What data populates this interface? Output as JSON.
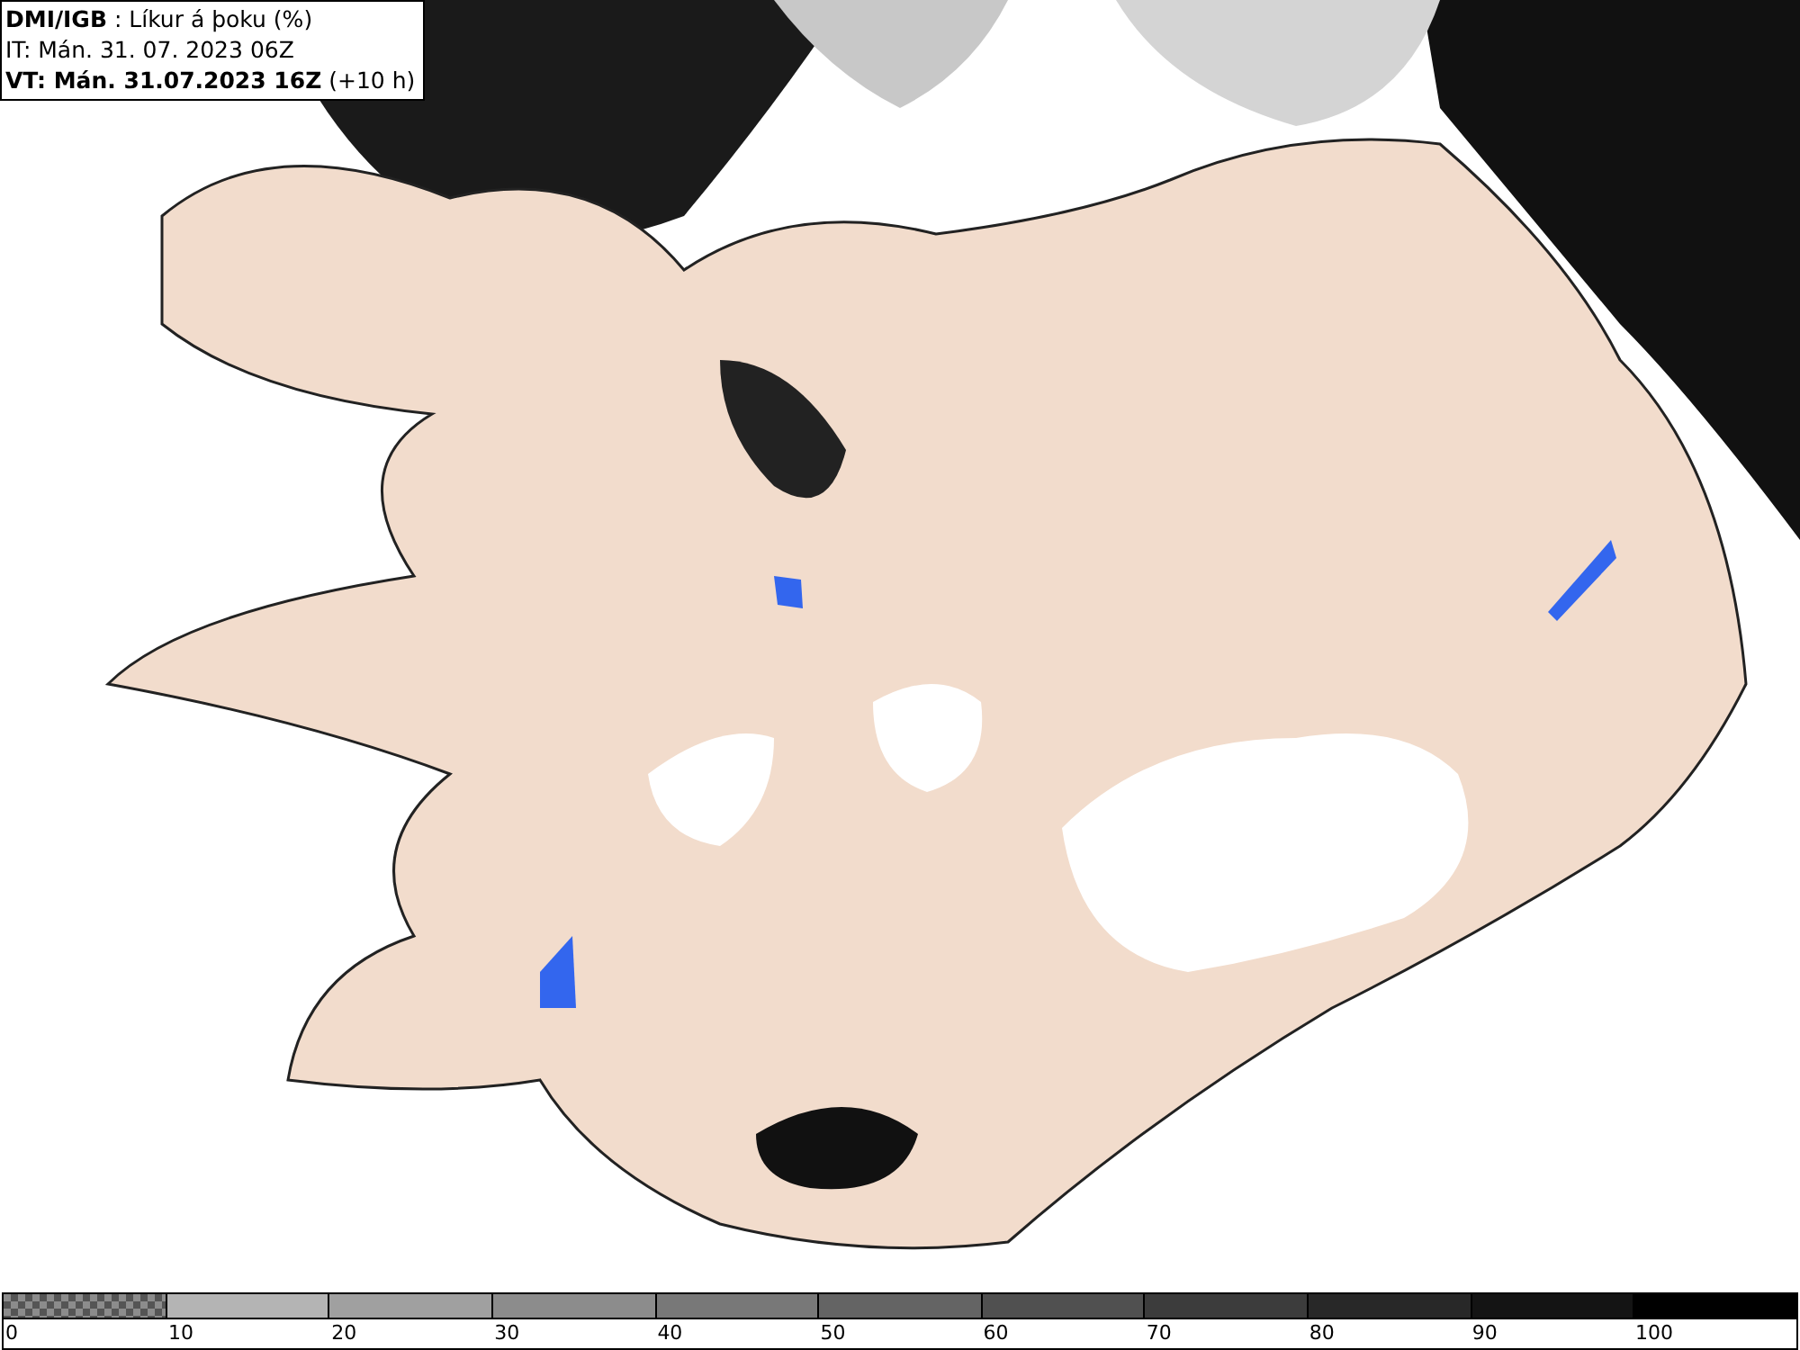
{
  "title_box": {
    "lines": [
      "**DMI/IGB** : Líkur á þoku (%)",
      "IT: Mán. 31. 07. 2023 06Z",
      "**VT: Mán. 31.07.2023 16Z** (+10 h)"
    ]
  },
  "legend": {
    "segments": [
      {
        "kind": "checker",
        "color": "#8c8c8c"
      },
      {
        "kind": "solid",
        "color": "#b4b4b4"
      },
      {
        "kind": "solid",
        "color": "#a0a0a0"
      },
      {
        "kind": "solid",
        "color": "#8c8c8c"
      },
      {
        "kind": "solid",
        "color": "#787878"
      },
      {
        "kind": "solid",
        "color": "#646464"
      },
      {
        "kind": "solid",
        "color": "#505050"
      },
      {
        "kind": "solid",
        "color": "#3c3c3c"
      },
      {
        "kind": "solid",
        "color": "#282828"
      },
      {
        "kind": "solid",
        "color": "#141414"
      },
      {
        "kind": "solid",
        "color": "#000000"
      }
    ],
    "labels": [
      "0",
      "10",
      "20",
      "30",
      "40",
      "50",
      "60",
      "70",
      "80",
      "90",
      "100"
    ]
  }
}
